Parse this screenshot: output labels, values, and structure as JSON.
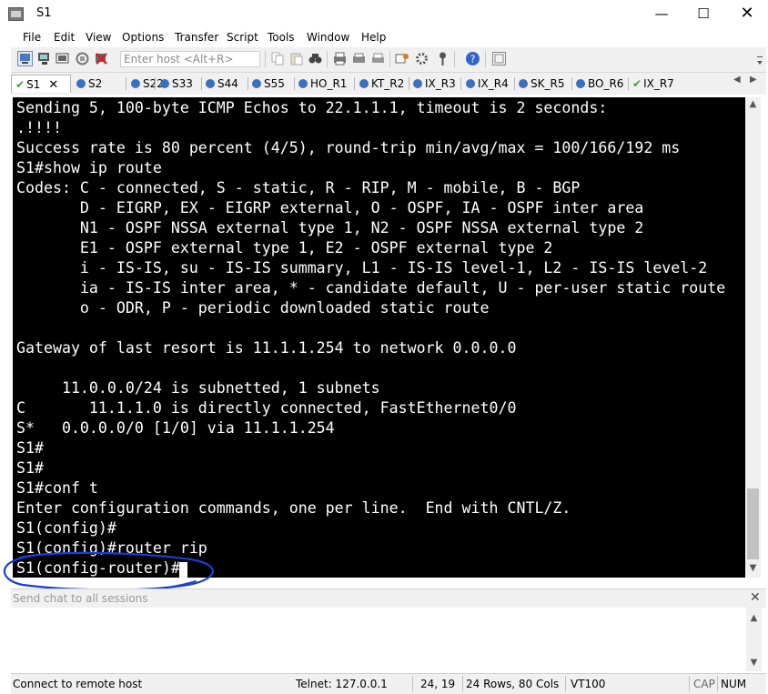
{
  "window": {
    "title": "S1"
  },
  "controls": {
    "minimize": "—",
    "maximize": "☐",
    "close": "✕"
  },
  "menu": [
    "File",
    "Edit",
    "View",
    "Options",
    "Transfer",
    "Script",
    "Tools",
    "Window",
    "Help"
  ],
  "toolbar": {
    "host_placeholder": "Enter host <Alt+R>"
  },
  "tabs": [
    {
      "label": "S1",
      "status": "connected",
      "active": true
    },
    {
      "label": "S2",
      "status": "idle"
    },
    {
      "label": "S22",
      "status": "idle"
    },
    {
      "label": "S33",
      "status": "idle"
    },
    {
      "label": "S44",
      "status": "idle"
    },
    {
      "label": "S55",
      "status": "idle"
    },
    {
      "label": "HO_R1",
      "status": "idle"
    },
    {
      "label": "KT_R2",
      "status": "idle"
    },
    {
      "label": "IX_R3",
      "status": "idle"
    },
    {
      "label": "IX_R4",
      "status": "idle"
    },
    {
      "label": "SK_R5",
      "status": "idle"
    },
    {
      "label": "BO_R6",
      "status": "idle"
    },
    {
      "label": "IX_R7",
      "status": "connected"
    }
  ],
  "terminal": {
    "lines": [
      "Sending 5, 100-byte ICMP Echos to 22.1.1.1, timeout is 2 seconds:",
      ".!!!!",
      "Success rate is 80 percent (4/5), round-trip min/avg/max = 100/166/192 ms",
      "S1#show ip route",
      "Codes: C - connected, S - static, R - RIP, M - mobile, B - BGP",
      "       D - EIGRP, EX - EIGRP external, O - OSPF, IA - OSPF inter area",
      "       N1 - OSPF NSSA external type 1, N2 - OSPF NSSA external type 2",
      "       E1 - OSPF external type 1, E2 - OSPF external type 2",
      "       i - IS-IS, su - IS-IS summary, L1 - IS-IS level-1, L2 - IS-IS level-2",
      "       ia - IS-IS inter area, * - candidate default, U - per-user static route",
      "       o - ODR, P - periodic downloaded static route",
      "",
      "Gateway of last resort is 11.1.1.254 to network 0.0.0.0",
      "",
      "     11.0.0.0/24 is subnetted, 1 subnets",
      "C       11.1.1.0 is directly connected, FastEthernet0/0",
      "S*   0.0.0.0/0 [1/0] via 11.1.1.254",
      "S1#",
      "S1#",
      "S1#conf t",
      "Enter configuration commands, one per line.  End with CNTL/Z.",
      "S1(config)#",
      "S1(config)#router rip",
      "S1(config-router)#"
    ]
  },
  "chat": {
    "placeholder": "Send chat to all sessions",
    "close": "✕"
  },
  "status": {
    "message": "Connect to remote host",
    "connection": "Telnet: 127.0.0.1",
    "position": "24,  19",
    "size": "24 Rows, 80 Cols",
    "emulation": "VT100",
    "caps": "CAP",
    "num": "NUM"
  },
  "colors": {
    "annotation": "#1b3fd0",
    "terminal_bg": "#000000",
    "terminal_fg": "#ffffff"
  }
}
